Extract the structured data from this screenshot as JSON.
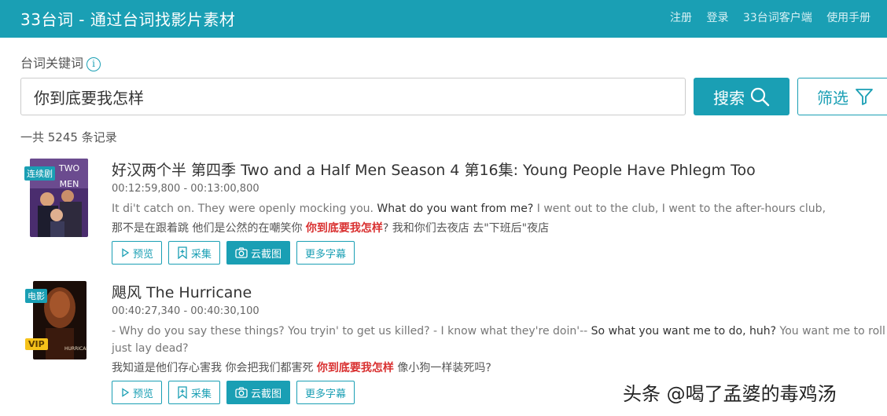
{
  "header": {
    "brand": "33台词 - 通过台词找影片素材",
    "nav": [
      "注册",
      "登录",
      "33台词客户端",
      "使用手册"
    ]
  },
  "search": {
    "label": "台词关键词",
    "info_icon": "info-icon",
    "value": "你到底要我怎样",
    "search_button": "搜索",
    "filter_button": "筛选"
  },
  "summary": {
    "count_text": "一共 5245 条记录"
  },
  "results": [
    {
      "badge": "连续剧",
      "title": "好汉两个半 第四季 Two and a Half Men Season 4 第16集: Young People Have Phlegm Too",
      "time": "00:12:59,800 - 00:13:00,800",
      "en_before": "It di't catch on. They were openly mocking you.",
      "en_match": "What do you want from me?",
      "en_after": "I went out to the club, I went to the after-hours club,",
      "zh_before": "那不是在跟着跳 他们是公然的在嘲笑你",
      "zh_match": "你到底要我怎样",
      "zh_after": "? 我和你们去夜店 去\"下班后\"夜店",
      "actions": {
        "preview": "预览",
        "collect": "采集",
        "screenshot": "云截图",
        "more": "更多字幕"
      }
    },
    {
      "badge": "电影",
      "vip": "VIP",
      "title": "飓风 The Hurricane",
      "time": "00:40:27,340 - 00:40:30,100",
      "en_before": "- Why do you say these things? You tryin' to get us killed? - I know what they're doin'--",
      "en_match": "So what you want me to do, huh?",
      "en_after": "You want me to roll over and",
      "en_cont": "just lay dead?",
      "zh_before": "我知道是他们存心害我 你会把我们都害死",
      "zh_match": "你到底要我怎样",
      "zh_after": "像小狗一样装死吗?",
      "actions": {
        "preview": "预览",
        "collect": "采集",
        "screenshot": "云截图",
        "more": "更多字幕"
      }
    }
  ],
  "watermark": "头条 @喝了孟婆的毒鸡汤",
  "colors": {
    "accent": "#1a9fb4",
    "highlight": "#d93030",
    "vip": "#f6c21a"
  }
}
